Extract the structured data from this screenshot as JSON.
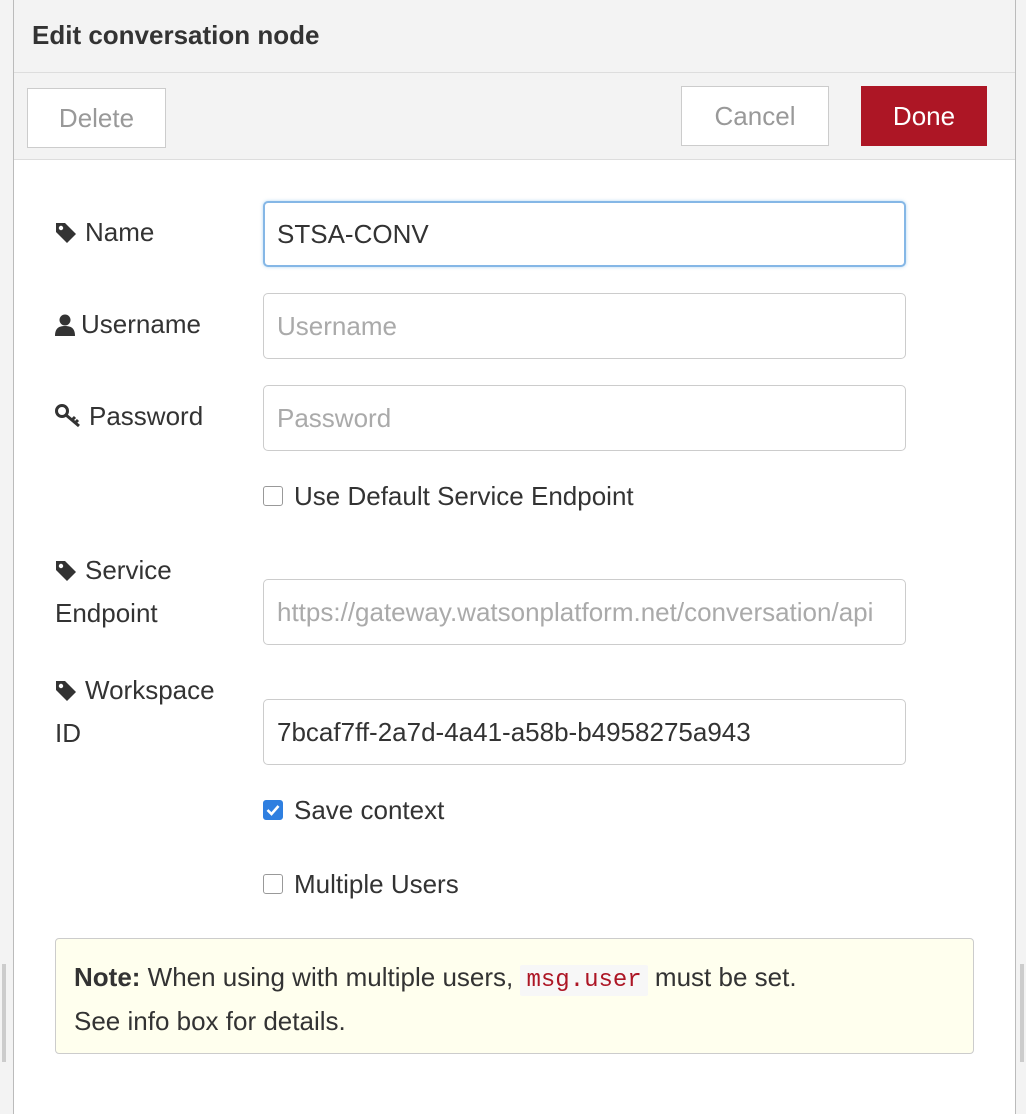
{
  "header": {
    "title": "Edit conversation node"
  },
  "toolbar": {
    "delete_label": "Delete",
    "cancel_label": "Cancel",
    "done_label": "Done"
  },
  "form": {
    "name": {
      "label": "Name",
      "value": "STSA-CONV",
      "icon": "tag-icon"
    },
    "username": {
      "label": "Username",
      "placeholder": "Username",
      "value": "",
      "icon": "user-icon"
    },
    "password": {
      "label": "Password",
      "placeholder": "Password",
      "value": "",
      "icon": "key-icon"
    },
    "use_default_endpoint": {
      "label": "Use Default Service Endpoint",
      "checked": false
    },
    "service_endpoint": {
      "label_line1": "Service",
      "label_line2": "Endpoint",
      "placeholder": "https://gateway.watsonplatform.net/conversation/api",
      "icon": "tag-icon"
    },
    "workspace_id": {
      "label_line1": "Workspace",
      "label_line2": "ID",
      "value": "7bcaf7ff-2a7d-4a41-a58b-b4958275a943",
      "icon": "tag-icon"
    },
    "save_context": {
      "label": "Save context",
      "checked": true
    },
    "multiple_users": {
      "label": "Multiple Users",
      "checked": false
    }
  },
  "note": {
    "strong": "Note:",
    "text_before": " When using with multiple users, ",
    "code": "msg.user",
    "text_after": " must be set.",
    "line2": "See info box for details."
  },
  "colors": {
    "done_button": "#ad1625",
    "checkbox_checked": "#2f7fe0",
    "note_background": "#ffffee",
    "focus_border": "#85b7e6"
  }
}
